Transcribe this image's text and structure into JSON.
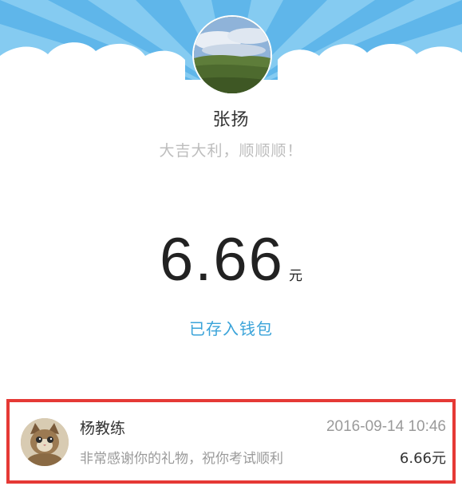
{
  "sender": {
    "name": "张扬",
    "greeting": "大吉大利，顺顺顺！",
    "avatar_icon": "landscape-photo-icon"
  },
  "amount": {
    "value": "6.66",
    "unit": "元"
  },
  "wallet_status": "已存入钱包",
  "record": {
    "name": "杨教练",
    "time": "2016-09-14 10:46",
    "message": "非常感谢你的礼物，祝你考试顺利",
    "amount": "6.66元",
    "avatar_icon": "kitten-photo-icon"
  },
  "colors": {
    "banner_sky": "#5fb6ea",
    "banner_ray": "#8ccff3",
    "cloud": "#ffffff",
    "link": "#3aa3d9",
    "highlight_border": "#e53935"
  }
}
